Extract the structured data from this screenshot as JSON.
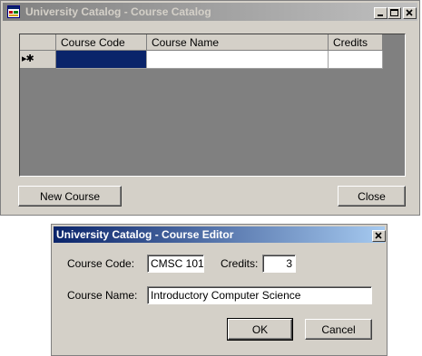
{
  "main_window": {
    "title": "University Catalog - Course Catalog",
    "grid": {
      "columns": [
        "Course Code",
        "Course Name",
        "Credits"
      ],
      "rows": [
        {
          "marker": "▸✱",
          "course_code": "",
          "course_name": "",
          "credits": ""
        }
      ]
    },
    "buttons": {
      "new_course": "New Course",
      "close": "Close"
    }
  },
  "dialog": {
    "title": "University Catalog - Course Editor",
    "course_code_label": "Course Code:",
    "course_code_value": "CMSC 101",
    "credits_label": "Credits:",
    "credits_value": "3",
    "course_name_label": "Course Name:",
    "course_name_value": "Introductory Computer Science",
    "buttons": {
      "ok": "OK",
      "cancel": "Cancel"
    }
  },
  "colors": {
    "window_bg": "#d4d0c8",
    "active_title": "#0a246a",
    "inactive_title": "#808080",
    "selection": "#0a246a",
    "grid_bg": "#808080"
  },
  "icons": {
    "app": "app-window-icon",
    "minimize": "minimize-icon",
    "maximize": "maximize-icon",
    "close": "close-icon",
    "row_marker": "current-new-row-icon"
  }
}
